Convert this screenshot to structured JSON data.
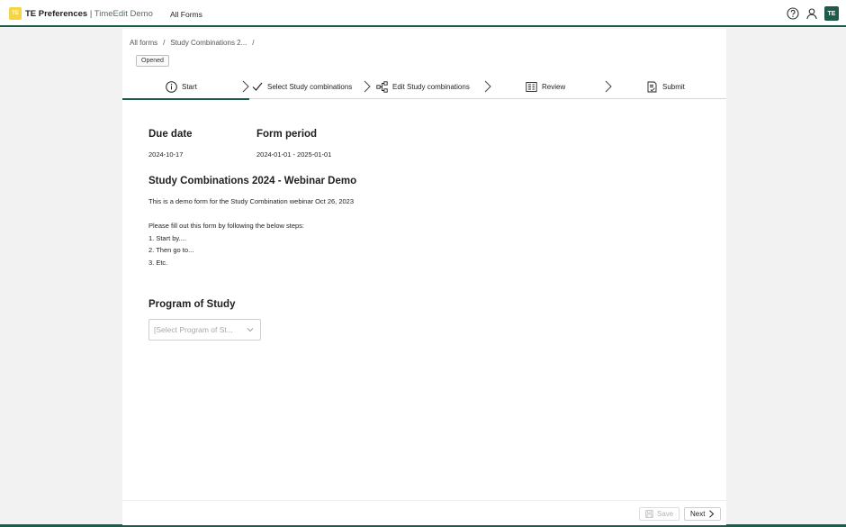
{
  "topbar": {
    "app_name": "TE Preferences",
    "separator": "|",
    "institution": "TimeEdit Demo",
    "nav_all_forms": "All Forms",
    "user_initials": "TE"
  },
  "breadcrumb": {
    "items": [
      "All forms",
      "/",
      "Study Combinations 2...",
      "/"
    ]
  },
  "status_badge": "Opened",
  "steps": [
    {
      "label": "Start"
    },
    {
      "label": "Select Study combinations"
    },
    {
      "label": "Edit Study combinations"
    },
    {
      "label": "Review"
    },
    {
      "label": "Submit"
    }
  ],
  "form": {
    "due_date_label": "Due date",
    "due_date_value": "2024-10-17",
    "period_label": "Form period",
    "period_value": "2024-01-01 - 2025-01-01",
    "title": "Study Combinations 2024 - Webinar Demo",
    "intro": "This is a demo form for the Study Combination webinar Oct 26, 2023",
    "instructions": [
      "Please fill out this form by following the below steps:",
      "1. Start by....",
      "2. Then go to...",
      "3. Etc."
    ],
    "program_label": "Program of Study",
    "program_placeholder": "[Select Program of St..."
  },
  "footer": {
    "save_label": "Save",
    "next_label": "Next"
  },
  "colors": {
    "brand_green": "#1f5b4c",
    "logo_yellow": "#f5d547"
  }
}
